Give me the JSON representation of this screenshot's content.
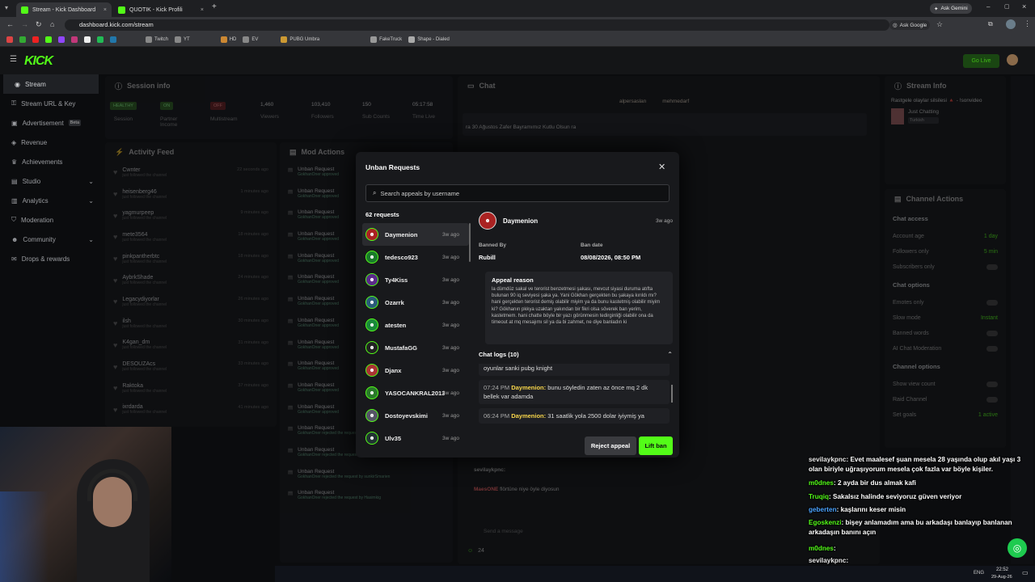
{
  "browser": {
    "tabs": [
      {
        "label": "Stream - Kick Dashboard"
      },
      {
        "label": "QUOTIK - Kick Profili"
      }
    ],
    "url": "dashboard.kick.com/stream",
    "ask_gemini": "Ask Gemini",
    "ask_google": "Ask Google",
    "bookmarks": [
      "Twitch",
      "YT",
      "HD",
      "EV",
      "PUBG Umbra",
      "FakeTruck",
      "Shape - Dialed"
    ]
  },
  "app": {
    "logo": "KICK",
    "go_live": "Go Live",
    "sidebar": [
      {
        "label": "Stream",
        "active": true
      },
      {
        "label": "Stream URL & Key"
      },
      {
        "label": "Advertisement",
        "badge": "Beta"
      },
      {
        "label": "Revenue"
      },
      {
        "label": "Achievements"
      },
      {
        "label": "Studio"
      },
      {
        "label": "Analytics"
      },
      {
        "label": "Moderation"
      },
      {
        "label": "Community"
      },
      {
        "label": "Drops & rewards"
      }
    ],
    "session": {
      "title": "Session info",
      "stats": [
        {
          "value": "HEALTHY",
          "label": "Session"
        },
        {
          "value": "ON",
          "label": "Partner Income"
        },
        {
          "value": "OFF",
          "label": "Multistream"
        },
        {
          "value": "1,460",
          "label": "Viewers"
        },
        {
          "value": "103,410",
          "label": "Followers"
        },
        {
          "value": "150",
          "label": "Sub Counts"
        },
        {
          "value": "05:17:58",
          "label": "Time Live"
        }
      ]
    },
    "activity": {
      "title": "Activity Feed",
      "items": [
        {
          "name": "Cwnter",
          "sub": "just followed the channel",
          "time": "22 seconds ago"
        },
        {
          "name": "heisenberg46",
          "sub": "just followed the channel",
          "time": "1 minutes ago"
        },
        {
          "name": "yagmurpeep",
          "sub": "just followed the channel",
          "time": "9 minutes ago"
        },
        {
          "name": "mete3564",
          "sub": "just followed the channel",
          "time": "18 minutes ago"
        },
        {
          "name": "pinkpantherbtc",
          "sub": "just followed the channel",
          "time": "18 minutes ago"
        },
        {
          "name": "AybrkShade",
          "sub": "just followed the channel",
          "time": "24 minutes ago"
        },
        {
          "name": "Legacydiyorlar",
          "sub": "just followed the channel",
          "time": "26 minutes ago"
        },
        {
          "name": "ilsh",
          "sub": "just followed the channel",
          "time": "30 minutes ago"
        },
        {
          "name": "K4gan_dm",
          "sub": "just followed the channel",
          "time": "31 minutes ago"
        },
        {
          "name": "DESOUZAcs",
          "sub": "just followed the channel",
          "time": "33 minutes ago"
        },
        {
          "name": "Raktoka",
          "sub": "just followed the channel",
          "time": "37 minutes ago"
        },
        {
          "name": "ixrdarda",
          "sub": "just followed the channel",
          "time": "41 minutes ago"
        }
      ]
    },
    "mod_actions": {
      "title": "Mod Actions",
      "items": [
        {
          "label": "Unban Request",
          "sub": "GokhanOner approved"
        },
        {
          "label": "Unban Request",
          "sub": "GokhanOner approved"
        },
        {
          "label": "Unban Request",
          "sub": "GokhanOner approved"
        },
        {
          "label": "Unban Request",
          "sub": "GokhanOner approved"
        },
        {
          "label": "Unban Request",
          "sub": "GokhanOner approved"
        },
        {
          "label": "Unban Request",
          "sub": "GokhanOner approved"
        },
        {
          "label": "Unban Request",
          "sub": "GokhanOner approved"
        },
        {
          "label": "Unban Request",
          "sub": "GokhanOner approved"
        },
        {
          "label": "Unban Request",
          "sub": "GokhanOner approved"
        },
        {
          "label": "Unban Request",
          "sub": "GokhanOner approved"
        },
        {
          "label": "Unban Request",
          "sub": "GokhanOner approved"
        },
        {
          "label": "Unban Request",
          "sub": "GokhanOner approved"
        },
        {
          "label": "Unban Request",
          "sub": "GokhanOner rejected the request by dissnothardaysidem"
        },
        {
          "label": "Unban Request",
          "sub": "GokhanOner rejected the request by NoNOO"
        },
        {
          "label": "Unban Request",
          "sub": "GokhanOner rejected the request by sunkirSmarien"
        },
        {
          "label": "Unban Request",
          "sub": "GokhanOner rejected the request by Hasimkig"
        }
      ]
    },
    "chat": {
      "title": "Chat",
      "pinned_users": [
        "alpersaslan",
        "mehmedarf"
      ],
      "pinned_msg": "ra 30 Ağustos Zafer Bayramımız Kutlu Olsun ra",
      "send_placeholder": "Send a message",
      "count": "24",
      "last_msgs": [
        {
          "user": "sevilaykpnc:",
          "text": ""
        },
        {
          "user": "MaesONE",
          "text": "flörtüne niye öyle diyosun"
        }
      ]
    },
    "stream_info": {
      "title": "Stream Info",
      "stream_title": "Rastgele olaylar silsilesi 🔺 - !sonvideo",
      "category": "Just Chatting",
      "language": "Turkish"
    },
    "channel_actions": {
      "title": "Channel Actions",
      "sections": [
        {
          "heading": "Chat access",
          "rows": [
            {
              "label": "Account age",
              "value": "1 day"
            },
            {
              "label": "Followers only",
              "value": "5 min"
            },
            {
              "label": "Subscribers only",
              "value": ""
            }
          ]
        },
        {
          "heading": "Chat options",
          "rows": [
            {
              "label": "Emotes only",
              "value": ""
            },
            {
              "label": "Slow mode",
              "value": "Instant"
            },
            {
              "label": "Banned words",
              "value": ""
            },
            {
              "label": "AI Chat Moderation",
              "value": ""
            }
          ]
        },
        {
          "heading": "Channel options",
          "rows": [
            {
              "label": "Show view count",
              "value": ""
            },
            {
              "label": "Raid Channel",
              "value": ""
            },
            {
              "label": "Set goals",
              "value": "1 active"
            }
          ]
        }
      ]
    }
  },
  "modal": {
    "title": "Unban Requests",
    "search_placeholder": "Search appeals by username",
    "count": "62 requests",
    "users": [
      {
        "name": "Daymenion",
        "ago": "3w ago"
      },
      {
        "name": "tedesco923",
        "ago": "3w ago"
      },
      {
        "name": "Ty4Kiss",
        "ago": "3w ago"
      },
      {
        "name": "Ozarrk",
        "ago": "3w ago"
      },
      {
        "name": "atesten",
        "ago": "3w ago"
      },
      {
        "name": "MustafaGG",
        "ago": "3w ago"
      },
      {
        "name": "Djanx",
        "ago": "3w ago"
      },
      {
        "name": "YASOCANKRAL2013",
        "ago": "3w ago"
      },
      {
        "name": "Dostoyevskimi",
        "ago": "3w ago"
      },
      {
        "name": "Ulv35",
        "ago": "3w ago"
      }
    ],
    "detail": {
      "name": "Daymenion",
      "ago": "3w ago",
      "banned_by_label": "Banned By",
      "banned_by": "Rubill",
      "ban_date_label": "Ban date",
      "ban_date": "08/08/2026, 08:50 PM",
      "appeal_label": "Appeal reason",
      "appeal_text": "la dümdüz sakal ve terorist benzetmesi şakası, mevcut siyasi duruma atıfta bulunan 90 iq seviyesi şaka ya. Yani Gökhan gerçekten bu şakaya kırıldı mı? hani gerçekten terorist demiş olabilir miyim ya da bunu kastetmiş olabilir miyim ki? Gökhanın pkkya uzaktan yakından bir fikri olsa söverek ban yerim, kastetmem. hani chatte böyle bir yazı görünmesin tedirginliği olabilir ona da timeout at mq mesajımı sil ya da bi zahmet, ne diye banladın ki",
      "chat_logs_label": "Chat logs (10)",
      "logs": [
        {
          "time": "",
          "user": "",
          "text": "oyunlar sanki pubg knight"
        },
        {
          "time": "07:24 PM",
          "user": "Daymenion:",
          "text": "bunu söyledin zaten az önce mq 2 dk bellek var adamda"
        },
        {
          "time": "06:24 PM",
          "user": "Daymenion:",
          "text": "31 saatlik yola 2500 dolar iyiymiş ya"
        }
      ],
      "reject": "Reject appeal",
      "lift": "Lift ban"
    }
  },
  "overlay_chat": [
    {
      "user": "sevilaykpnc",
      "color": "#e8e8e8",
      "text": ": Evet maalesef şuan mesela 28 yaşında olup akıl yaşı 3 olan biriyle uğraşıyorum mesela çok fazla var böyle kişiler."
    },
    {
      "user": "m0dnes",
      "color": "#53fc18",
      "text": ": 2 ayda bir dus almak kafi"
    },
    {
      "user": "Truqiq",
      "color": "#53fc18",
      "text": ": Sakalsız halinde seviyoruz güven veriyor"
    },
    {
      "user": "geberten",
      "color": "#4aa3ff",
      "text": ": kaşlarını keser misin"
    },
    {
      "user": "Egoskenzi",
      "color": "#53fc18",
      "text": ": bişey anlamadım ama bu arkadaşı banlayıp banlanan arkadaşın banını açın"
    },
    {
      "user": "m0dnes",
      "color": "#53fc18",
      "text": ":"
    },
    {
      "user": "sevilaykpnc",
      "color": "#e8e8e8",
      "text": ":"
    },
    {
      "user": "MaesONE",
      "color": "#ff4d4d",
      "text": ": flörtüne niye öyle diyosun"
    }
  ],
  "taskbar": {
    "lang": "ENG",
    "time": "22:52",
    "date": "29-Aug-26"
  }
}
